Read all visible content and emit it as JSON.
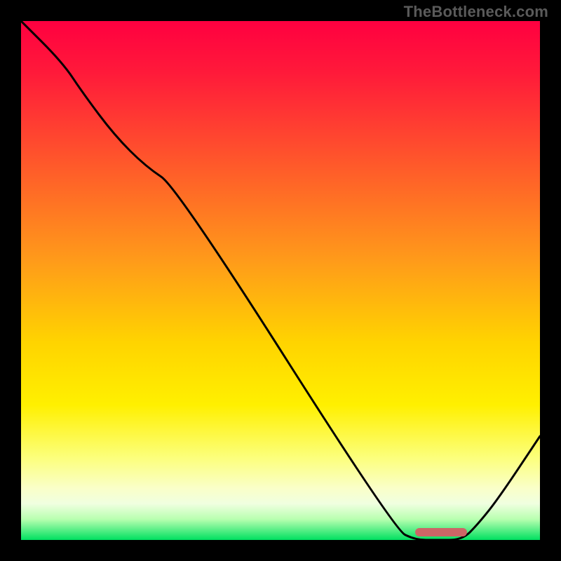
{
  "watermark": "TheBottleneck.com",
  "colors": {
    "curve": "#000000",
    "marker": "#cc6666",
    "background_top": "#ff0040",
    "background_bottom": "#00e060"
  },
  "chart_data": {
    "type": "line",
    "title": "",
    "xlabel": "",
    "ylabel": "",
    "xlim": [
      0,
      100
    ],
    "ylim": [
      0,
      100
    ],
    "grid": false,
    "series": [
      {
        "name": "curve",
        "x": [
          0,
          8,
          12,
          18,
          24,
          30,
          72,
          76,
          80,
          85,
          88,
          92,
          100
        ],
        "values": [
          100,
          92,
          86,
          78,
          72,
          68,
          2,
          0,
          0,
          0,
          3,
          8,
          20
        ]
      }
    ],
    "marker": {
      "x_start": 76,
      "x_end": 86,
      "y": 1.5
    },
    "annotations": []
  }
}
